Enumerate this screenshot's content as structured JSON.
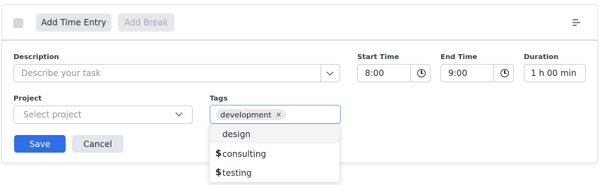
{
  "toolbar": {
    "add_time_entry_label": "Add Time Entry",
    "add_break_label": "Add Break"
  },
  "form": {
    "description": {
      "label": "Description",
      "placeholder": "Describe your task",
      "value": ""
    },
    "start_time": {
      "label": "Start Time",
      "value": "8:00"
    },
    "end_time": {
      "label": "End Time",
      "value": "9:00"
    },
    "duration": {
      "label": "Duration",
      "value": "1 h 00 min"
    },
    "project": {
      "label": "Project",
      "placeholder": "Select project"
    },
    "tags": {
      "label": "Tags",
      "selected": [
        "development"
      ],
      "remove_symbol": "×"
    },
    "save_label": "Save",
    "cancel_label": "Cancel"
  },
  "tags_dropdown": {
    "options": [
      {
        "label": "design",
        "billable": false,
        "highlighted": true
      },
      {
        "label": "consulting",
        "billable": true,
        "highlighted": false
      },
      {
        "label": "testing",
        "billable": true,
        "highlighted": false
      }
    ],
    "billable_symbol": "$"
  },
  "icons": {
    "checkbox": "checkbox-icon",
    "menu": "menu-icon",
    "chevron": "chevron-down-icon",
    "clock": "clock-icon",
    "remove": "close-icon"
  },
  "colors": {
    "primary": "#2e6ee6",
    "button_gray": "#e3e6ea",
    "disabled_text": "#a4a9b1",
    "border": "#ccd0d6"
  }
}
